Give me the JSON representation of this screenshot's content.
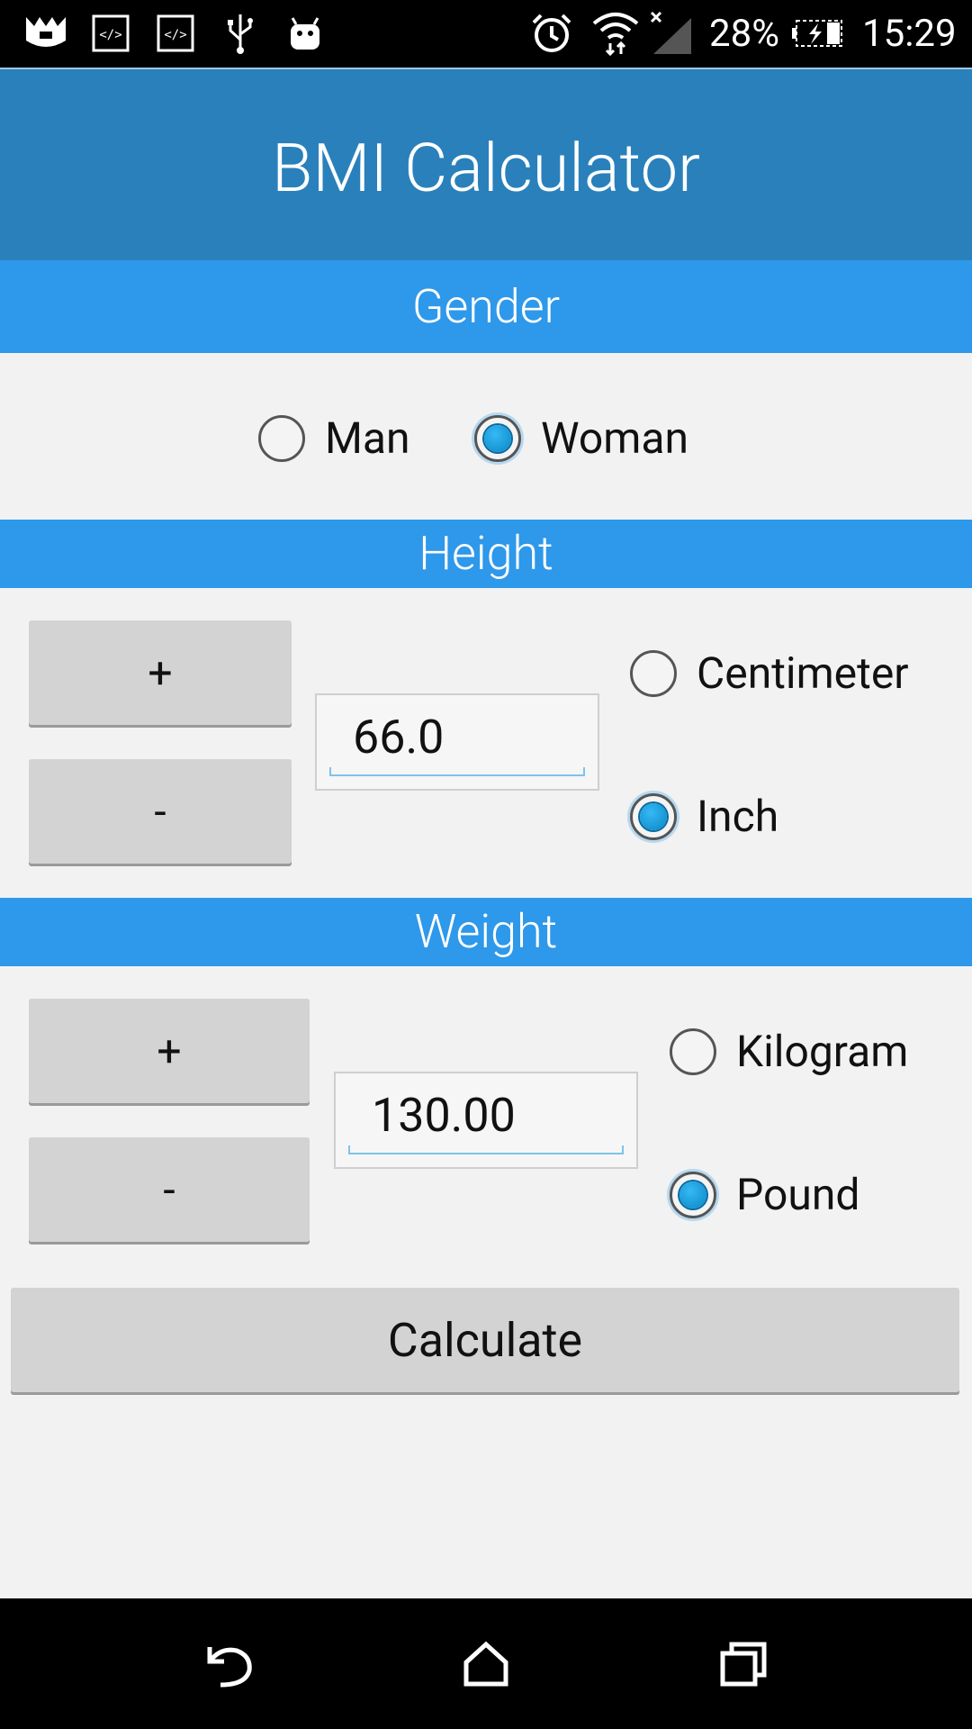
{
  "status_bar": {
    "battery_percent": "28%",
    "time": "15:29",
    "icons_left": [
      "crown-app-icon",
      "code-icon",
      "code-icon",
      "usb-icon",
      "android-icon"
    ],
    "icons_right": [
      "alarm-icon",
      "wifi-icon",
      "signal-icon",
      "battery-charging-icon"
    ]
  },
  "app": {
    "title": "BMI Calculator"
  },
  "gender": {
    "header": "Gender",
    "options": [
      {
        "label": "Man",
        "checked": false
      },
      {
        "label": "Woman",
        "checked": true
      }
    ]
  },
  "height": {
    "header": "Height",
    "plus_label": "+",
    "minus_label": "-",
    "value": "66.0",
    "units": [
      {
        "label": "Centimeter",
        "checked": false
      },
      {
        "label": "Inch",
        "checked": true
      }
    ]
  },
  "weight": {
    "header": "Weight",
    "plus_label": "+",
    "minus_label": "-",
    "value": "130.00",
    "units": [
      {
        "label": "Kilogram",
        "checked": false
      },
      {
        "label": "Pound",
        "checked": true
      }
    ]
  },
  "calculate_label": "Calculate",
  "colors": {
    "app_bar": "#2a80bb",
    "section_header": "#2e98ea",
    "radio_checked": "#1aa0e0",
    "button": "#d3d3d3"
  }
}
